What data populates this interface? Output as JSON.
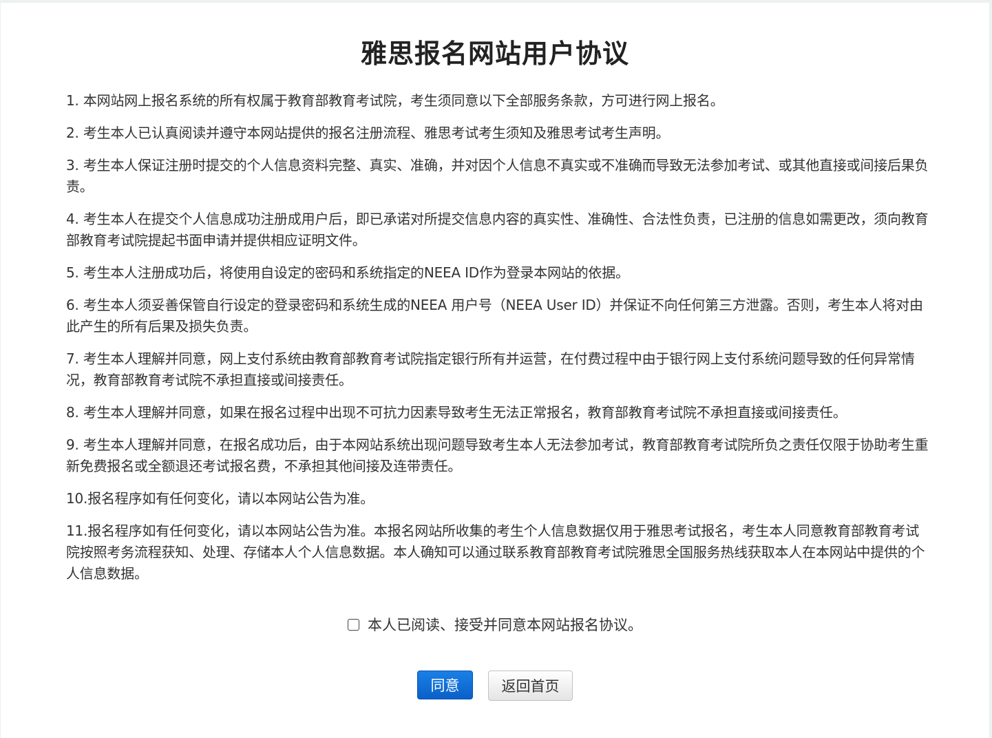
{
  "page": {
    "title": "雅思报名网站用户协议"
  },
  "terms": [
    "1. 本网站网上报名系统的所有权属于教育部教育考试院，考生须同意以下全部服务条款，方可进行网上报名。",
    "2. 考生本人已认真阅读并遵守本网站提供的报名注册流程、雅思考试考生须知及雅思考试考生声明。",
    "3. 考生本人保证注册时提交的个人信息资料完整、真实、准确，并对因个人信息不真实或不准确而导致无法参加考试、或其他直接或间接后果负责。",
    "4. 考生本人在提交个人信息成功注册成用户后，即已承诺对所提交信息内容的真实性、准确性、合法性负责，已注册的信息如需更改，须向教育部教育考试院提起书面申请并提供相应证明文件。",
    "5. 考生本人注册成功后，将使用自设定的密码和系统指定的NEEA ID作为登录本网站的依据。",
    "6. 考生本人须妥善保管自行设定的登录密码和系统生成的NEEA 用户号（NEEA User ID）并保证不向任何第三方泄露。否则，考生本人将对由此产生的所有后果及损失负责。",
    "7. 考生本人理解并同意，网上支付系统由教育部教育考试院指定银行所有并运营，在付费过程中由于银行网上支付系统问题导致的任何异常情况，教育部教育考试院不承担直接或间接责任。",
    "8. 考生本人理解并同意，如果在报名过程中出现不可抗力因素导致考生无法正常报名，教育部教育考试院不承担直接或间接责任。",
    "9. 考生本人理解并同意，在报名成功后，由于本网站系统出现问题导致考生本人无法参加考试，教育部教育考试院所负之责任仅限于协助考生重新免费报名或全额退还考试报名费，不承担其他间接及连带责任。",
    "10.报名程序如有任何变化，请以本网站公告为准。",
    "11.报名程序如有任何变化，请以本网站公告为准。本报名网站所收集的考生个人信息数据仅用于雅思考试报名，考生本人同意教育部教育考试院按照考务流程获知、处理、存储本人个人信息数据。本人确知可以通过联系教育部教育考试院雅思全国服务热线获取本人在本网站中提供的个人信息数据。"
  ],
  "agreement": {
    "checkbox_label": "本人已阅读、接受并同意本网站报名协议。",
    "checked": false
  },
  "buttons": {
    "agree_label": "同意",
    "home_label": "返回首页"
  },
  "colors": {
    "primary": "#0a6ad4",
    "background": "#eef1f1",
    "text": "#333333"
  }
}
